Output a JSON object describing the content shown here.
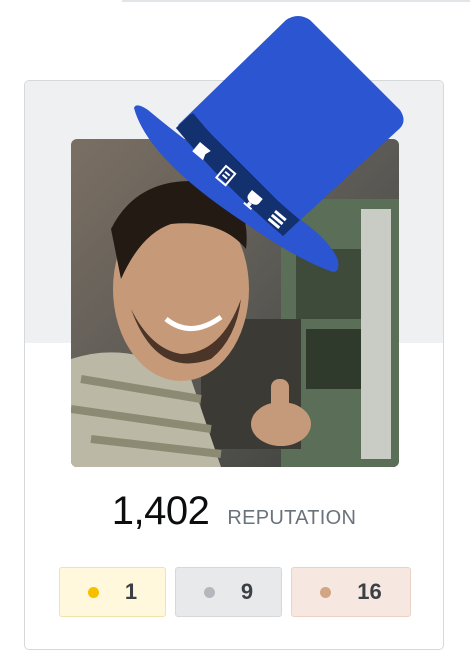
{
  "profile": {
    "reputation_value": "1,402",
    "reputation_label": "REPUTATION"
  },
  "badges": [
    {
      "type": "gold",
      "count": "1",
      "color": "#f6c000"
    },
    {
      "type": "silver",
      "count": "9",
      "color": "#b4b8bc"
    },
    {
      "type": "bronze",
      "count": "16",
      "color": "#d1a684"
    }
  ],
  "hat": {
    "color": "#2b55d1",
    "band_color": "#0f2a6b",
    "band_icons": [
      "flag-icon",
      "document-icon",
      "trophy-icon",
      "list-icon"
    ]
  }
}
